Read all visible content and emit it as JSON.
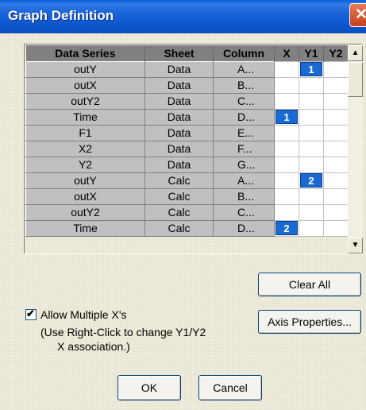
{
  "window": {
    "title": "Graph Definition",
    "close_glyph": "✕"
  },
  "grid": {
    "headers": [
      "Data Series",
      "Sheet",
      "Column",
      "X",
      "Y1",
      "Y2"
    ],
    "rows": [
      {
        "series": "outY",
        "sheet": "Data",
        "column": "A...",
        "x": "",
        "y1": "1",
        "y2": ""
      },
      {
        "series": "outX",
        "sheet": "Data",
        "column": "B...",
        "x": "",
        "y1": "",
        "y2": ""
      },
      {
        "series": "outY2",
        "sheet": "Data",
        "column": "C...",
        "x": "",
        "y1": "",
        "y2": ""
      },
      {
        "series": "Time",
        "sheet": "Data",
        "column": "D...",
        "x": "1",
        "y1": "",
        "y2": ""
      },
      {
        "series": "F1",
        "sheet": "Data",
        "column": "E...",
        "x": "",
        "y1": "",
        "y2": ""
      },
      {
        "series": "X2",
        "sheet": "Data",
        "column": "F...",
        "x": "",
        "y1": "",
        "y2": ""
      },
      {
        "series": "Y2",
        "sheet": "Data",
        "column": "G...",
        "x": "",
        "y1": "",
        "y2": ""
      },
      {
        "series": "outY",
        "sheet": "Calc",
        "column": "A...",
        "x": "",
        "y1": "2",
        "y2": ""
      },
      {
        "series": "outX",
        "sheet": "Calc",
        "column": "B...",
        "x": "",
        "y1": "",
        "y2": ""
      },
      {
        "series": "outY2",
        "sheet": "Calc",
        "column": "C...",
        "x": "",
        "y1": "",
        "y2": ""
      },
      {
        "series": "Time",
        "sheet": "Calc",
        "column": "D...",
        "x": "2",
        "y1": "",
        "y2": ""
      }
    ],
    "badge_color": "#1a6ad2"
  },
  "scrollbar": {
    "up_icon": "▲",
    "down_icon": "▼"
  },
  "buttons": {
    "clear_all": "Clear All",
    "axis_properties": "Axis Properties...",
    "ok": "OK",
    "cancel": "Cancel"
  },
  "options": {
    "allow_multiple_x_label": "Allow Multiple X's",
    "allow_multiple_x_checked": true,
    "check_glyph": "✔",
    "hint_line1": "(Use Right-Click to change Y1/Y2",
    "hint_line2": "X association.)"
  },
  "colors": {
    "titlebar": "#0b56cc",
    "header": "#808080",
    "cell_gray": "#c0c0c0"
  }
}
